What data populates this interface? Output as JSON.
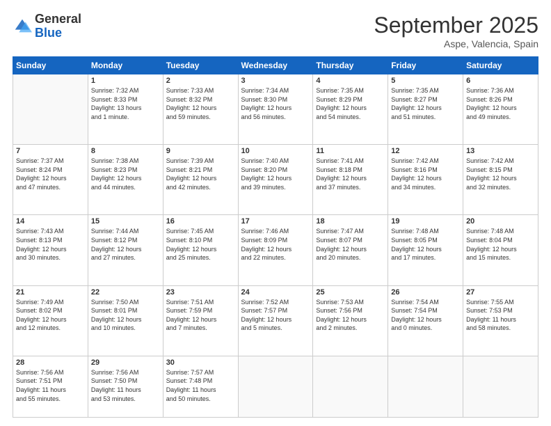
{
  "header": {
    "logo_general": "General",
    "logo_blue": "Blue",
    "title": "September 2025",
    "location": "Aspe, Valencia, Spain"
  },
  "weekdays": [
    "Sunday",
    "Monday",
    "Tuesday",
    "Wednesday",
    "Thursday",
    "Friday",
    "Saturday"
  ],
  "weeks": [
    [
      {
        "day": "",
        "info": ""
      },
      {
        "day": "1",
        "info": "Sunrise: 7:32 AM\nSunset: 8:33 PM\nDaylight: 13 hours\nand 1 minute."
      },
      {
        "day": "2",
        "info": "Sunrise: 7:33 AM\nSunset: 8:32 PM\nDaylight: 12 hours\nand 59 minutes."
      },
      {
        "day": "3",
        "info": "Sunrise: 7:34 AM\nSunset: 8:30 PM\nDaylight: 12 hours\nand 56 minutes."
      },
      {
        "day": "4",
        "info": "Sunrise: 7:35 AM\nSunset: 8:29 PM\nDaylight: 12 hours\nand 54 minutes."
      },
      {
        "day": "5",
        "info": "Sunrise: 7:35 AM\nSunset: 8:27 PM\nDaylight: 12 hours\nand 51 minutes."
      },
      {
        "day": "6",
        "info": "Sunrise: 7:36 AM\nSunset: 8:26 PM\nDaylight: 12 hours\nand 49 minutes."
      }
    ],
    [
      {
        "day": "7",
        "info": "Sunrise: 7:37 AM\nSunset: 8:24 PM\nDaylight: 12 hours\nand 47 minutes."
      },
      {
        "day": "8",
        "info": "Sunrise: 7:38 AM\nSunset: 8:23 PM\nDaylight: 12 hours\nand 44 minutes."
      },
      {
        "day": "9",
        "info": "Sunrise: 7:39 AM\nSunset: 8:21 PM\nDaylight: 12 hours\nand 42 minutes."
      },
      {
        "day": "10",
        "info": "Sunrise: 7:40 AM\nSunset: 8:20 PM\nDaylight: 12 hours\nand 39 minutes."
      },
      {
        "day": "11",
        "info": "Sunrise: 7:41 AM\nSunset: 8:18 PM\nDaylight: 12 hours\nand 37 minutes."
      },
      {
        "day": "12",
        "info": "Sunrise: 7:42 AM\nSunset: 8:16 PM\nDaylight: 12 hours\nand 34 minutes."
      },
      {
        "day": "13",
        "info": "Sunrise: 7:42 AM\nSunset: 8:15 PM\nDaylight: 12 hours\nand 32 minutes."
      }
    ],
    [
      {
        "day": "14",
        "info": "Sunrise: 7:43 AM\nSunset: 8:13 PM\nDaylight: 12 hours\nand 30 minutes."
      },
      {
        "day": "15",
        "info": "Sunrise: 7:44 AM\nSunset: 8:12 PM\nDaylight: 12 hours\nand 27 minutes."
      },
      {
        "day": "16",
        "info": "Sunrise: 7:45 AM\nSunset: 8:10 PM\nDaylight: 12 hours\nand 25 minutes."
      },
      {
        "day": "17",
        "info": "Sunrise: 7:46 AM\nSunset: 8:09 PM\nDaylight: 12 hours\nand 22 minutes."
      },
      {
        "day": "18",
        "info": "Sunrise: 7:47 AM\nSunset: 8:07 PM\nDaylight: 12 hours\nand 20 minutes."
      },
      {
        "day": "19",
        "info": "Sunrise: 7:48 AM\nSunset: 8:05 PM\nDaylight: 12 hours\nand 17 minutes."
      },
      {
        "day": "20",
        "info": "Sunrise: 7:48 AM\nSunset: 8:04 PM\nDaylight: 12 hours\nand 15 minutes."
      }
    ],
    [
      {
        "day": "21",
        "info": "Sunrise: 7:49 AM\nSunset: 8:02 PM\nDaylight: 12 hours\nand 12 minutes."
      },
      {
        "day": "22",
        "info": "Sunrise: 7:50 AM\nSunset: 8:01 PM\nDaylight: 12 hours\nand 10 minutes."
      },
      {
        "day": "23",
        "info": "Sunrise: 7:51 AM\nSunset: 7:59 PM\nDaylight: 12 hours\nand 7 minutes."
      },
      {
        "day": "24",
        "info": "Sunrise: 7:52 AM\nSunset: 7:57 PM\nDaylight: 12 hours\nand 5 minutes."
      },
      {
        "day": "25",
        "info": "Sunrise: 7:53 AM\nSunset: 7:56 PM\nDaylight: 12 hours\nand 2 minutes."
      },
      {
        "day": "26",
        "info": "Sunrise: 7:54 AM\nSunset: 7:54 PM\nDaylight: 12 hours\nand 0 minutes."
      },
      {
        "day": "27",
        "info": "Sunrise: 7:55 AM\nSunset: 7:53 PM\nDaylight: 11 hours\nand 58 minutes."
      }
    ],
    [
      {
        "day": "28",
        "info": "Sunrise: 7:56 AM\nSunset: 7:51 PM\nDaylight: 11 hours\nand 55 minutes."
      },
      {
        "day": "29",
        "info": "Sunrise: 7:56 AM\nSunset: 7:50 PM\nDaylight: 11 hours\nand 53 minutes."
      },
      {
        "day": "30",
        "info": "Sunrise: 7:57 AM\nSunset: 7:48 PM\nDaylight: 11 hours\nand 50 minutes."
      },
      {
        "day": "",
        "info": ""
      },
      {
        "day": "",
        "info": ""
      },
      {
        "day": "",
        "info": ""
      },
      {
        "day": "",
        "info": ""
      }
    ]
  ]
}
